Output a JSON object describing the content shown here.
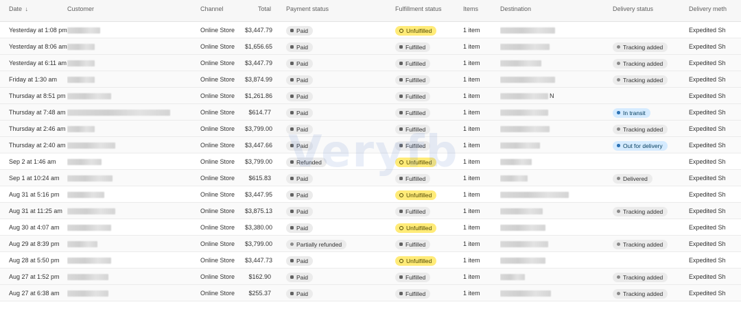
{
  "headers": {
    "date": "Date",
    "customer": "Customer",
    "channel": "Channel",
    "total": "Total",
    "payment": "Payment status",
    "fulfillment": "Fulfillment status",
    "items": "Items",
    "destination": "Destination",
    "delivery": "Delivery status",
    "delivery_method": "Delivery meth"
  },
  "watermark": "Veryfb",
  "rows": [
    {
      "date": "Yesterday at 1:08 pm",
      "customer_tail": "",
      "channel": "Online Store",
      "total": "$3,447.79",
      "payment": "Paid",
      "fulfillment": "Unfulfilled",
      "items": "1 item",
      "dest_tail": "",
      "delivery": "",
      "method": "Expedited Sh"
    },
    {
      "date": "Yesterday at 8:06 am",
      "customer_tail": "",
      "channel": "Online Store",
      "total": "$1,656.65",
      "payment": "Paid",
      "fulfillment": "Fulfilled",
      "items": "1 item",
      "dest_tail": "",
      "delivery": "Tracking added",
      "method": "Expedited Sh"
    },
    {
      "date": "Yesterday at 6:11 am",
      "customer_tail": "",
      "channel": "Online Store",
      "total": "$3,447.79",
      "payment": "Paid",
      "fulfillment": "Fulfilled",
      "items": "1 item",
      "dest_tail": "",
      "delivery": "Tracking added",
      "method": "Expedited Sh"
    },
    {
      "date": "Friday at 1:30 am",
      "customer_tail": "",
      "channel": "Online Store",
      "total": "$3,874.99",
      "payment": "Paid",
      "fulfillment": "Fulfilled",
      "items": "1 item",
      "dest_tail": "",
      "delivery": "Tracking added",
      "method": "Expedited Sh"
    },
    {
      "date": "Thursday at 8:51 pm",
      "customer_tail": "",
      "channel": "Online Store",
      "total": "$1,261.86",
      "payment": "Paid",
      "fulfillment": "Fulfilled",
      "items": "1 item",
      "dest_tail": "N",
      "delivery": "",
      "method": "Expedited Sh"
    },
    {
      "date": "Thursday at 7:48 am",
      "customer_tail": "",
      "channel": "Online Store",
      "total": "$614.77",
      "payment": "Paid",
      "fulfillment": "Fulfilled",
      "items": "1 item",
      "dest_tail": "",
      "delivery": "In transit",
      "method": "Expedited Sh"
    },
    {
      "date": "Thursday at 2:46 am",
      "customer_tail": "",
      "channel": "Online Store",
      "total": "$3,799.00",
      "payment": "Paid",
      "fulfillment": "Fulfilled",
      "items": "1 item",
      "dest_tail": "",
      "delivery": "Tracking added",
      "method": "Expedited Sh"
    },
    {
      "date": "Thursday at 2:40 am",
      "customer_tail": "",
      "channel": "Online Store",
      "total": "$3,447.66",
      "payment": "Paid",
      "fulfillment": "Fulfilled",
      "items": "1 item",
      "dest_tail": "",
      "delivery": "Out for delivery",
      "method": "Expedited Sh"
    },
    {
      "date": "Sep 2 at 1:46 am",
      "customer_tail": "",
      "channel": "Online Store",
      "total": "$3,799.00",
      "payment": "Refunded",
      "fulfillment": "Unfulfilled",
      "items": "1 item",
      "dest_tail": "",
      "delivery": "",
      "method": "Expedited Sh"
    },
    {
      "date": "Sep 1 at 10:24 am",
      "customer_tail": "",
      "channel": "Online Store",
      "total": "$615.83",
      "payment": "Paid",
      "fulfillment": "Fulfilled",
      "items": "1 item",
      "dest_tail": "",
      "delivery": "Delivered",
      "method": "Expedited Sh"
    },
    {
      "date": "Aug 31 at 5:16 pm",
      "customer_tail": "",
      "channel": "Online Store",
      "total": "$3,447.95",
      "payment": "Paid",
      "fulfillment": "Unfulfilled",
      "items": "1 item",
      "dest_tail": "",
      "delivery": "",
      "method": "Expedited Sh"
    },
    {
      "date": "Aug 31 at 11:25 am",
      "customer_tail": "",
      "channel": "Online Store",
      "total": "$3,875.13",
      "payment": "Paid",
      "fulfillment": "Fulfilled",
      "items": "1 item",
      "dest_tail": "",
      "delivery": "Tracking added",
      "method": "Expedited Sh"
    },
    {
      "date": "Aug 30 at 4:07 am",
      "customer_tail": "",
      "channel": "Online Store",
      "total": "$3,380.00",
      "payment": "Paid",
      "fulfillment": "Unfulfilled",
      "items": "1 item",
      "dest_tail": "",
      "delivery": "",
      "method": "Expedited Sh"
    },
    {
      "date": "Aug 29 at 8:39 pm",
      "customer_tail": "",
      "channel": "Online Store",
      "total": "$3,799.00",
      "payment": "Partially refunded",
      "fulfillment": "Fulfilled",
      "items": "1 item",
      "dest_tail": "",
      "delivery": "Tracking added",
      "method": "Expedited Sh"
    },
    {
      "date": "Aug 28 at 5:50 pm",
      "customer_tail": "",
      "channel": "Online Store",
      "total": "$3,447.73",
      "payment": "Paid",
      "fulfillment": "Unfulfilled",
      "items": "1 item",
      "dest_tail": "",
      "delivery": "",
      "method": "Expedited Sh"
    },
    {
      "date": "Aug 27 at 1:52 pm",
      "customer_tail": "",
      "channel": "Online Store",
      "total": "$162.90",
      "payment": "Paid",
      "fulfillment": "Fulfilled",
      "items": "1 item",
      "dest_tail": "",
      "delivery": "Tracking added",
      "method": "Expedited Sh"
    },
    {
      "date": "Aug 27 at 6:38 am",
      "customer_tail": "",
      "channel": "Online Store",
      "total": "$255.37",
      "payment": "Paid",
      "fulfillment": "Fulfilled",
      "items": "1 item",
      "dest_tail": "",
      "delivery": "Tracking added",
      "method": "Expedited Sh"
    }
  ],
  "colors": {
    "unfulfilled_badge": "#ffeb78",
    "info_badge": "#d5ebff",
    "neutral_badge": "#ebebeb",
    "header_bg": "#f7f7f7"
  }
}
